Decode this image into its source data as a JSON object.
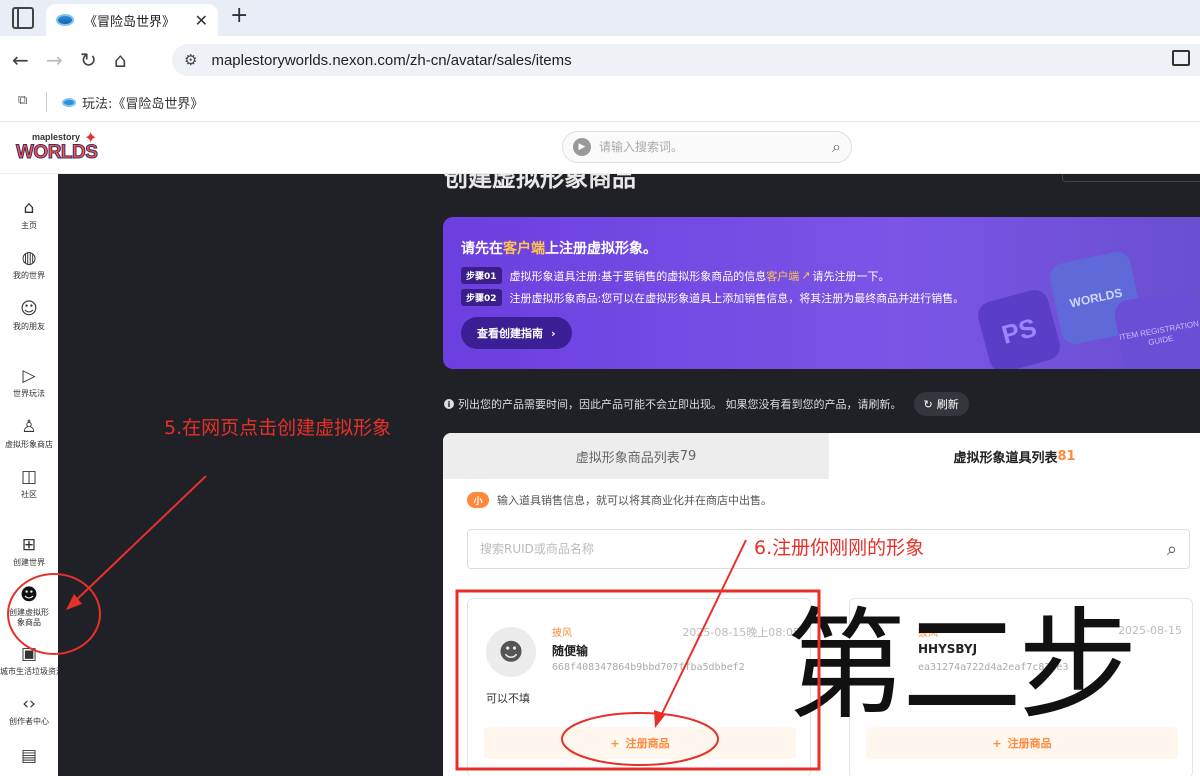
{
  "browser": {
    "tab_title": "《冒险岛世界》",
    "url": "maplestoryworlds.nexon.com/zh-cn/avatar/sales/items",
    "bookmark": "玩法:《冒险岛世界》"
  },
  "site": {
    "logo_small": "maplestory",
    "logo_big": "WORLDS",
    "search_placeholder": "请输入搜索词。"
  },
  "nav": [
    {
      "label": "主页"
    },
    {
      "label": "我的世界"
    },
    {
      "label": "我的朋友"
    },
    {
      "label": "世界玩法"
    },
    {
      "label": "虚拟形象商店"
    },
    {
      "label": "社区"
    },
    {
      "label": "创建世界"
    },
    {
      "label": "创建虚拟形象商品"
    },
    {
      "label": "城市生活垃圾资源"
    },
    {
      "label": "创作者中心"
    }
  ],
  "page": {
    "partial_title": "创建虚拟形象商品"
  },
  "banner": {
    "title_pre": "请先在",
    "title_hl": "客户端",
    "title_post": "上注册虚拟形象。",
    "step1_badge": "步骤01",
    "step1_pre": "虚拟形象道具注册:基于要销售的虚拟形象商品的信息",
    "step1_hl": "客户端",
    "step1_post": "请先注册一下。",
    "step2_badge": "步骤02",
    "step2_text": "注册虚拟形象商品:您可以在虚拟形象道具上添加销售信息，将其注册为最终商品并进行销售。",
    "guide_button": "查看创建指南",
    "deco_ps": "PS",
    "deco_worlds": "WORLDS",
    "deco_guide": "ITEM REGISTRATION GUIDE"
  },
  "notice": {
    "text": "列出您的产品需要时间，因此产品可能不会立即出现。 如果您没有看到您的产品，请刷新。",
    "refresh": "刷新"
  },
  "tabs": {
    "tab_a_label": "虚拟形象商品列表",
    "tab_a_count": "79",
    "tab_b_label": "虚拟形象道具列表",
    "tab_b_count": "81"
  },
  "tip": {
    "badge": "小",
    "text": "输入道具销售信息，就可以将其商业化并在商店中出售。"
  },
  "item_search_placeholder": "搜索RUID或商品名称",
  "cards": [
    {
      "category": "披风",
      "date": "2025-08-15晚上08:05",
      "name": "随便输",
      "id": "668f408347864b9bbd707ffba5dbbef2",
      "note": "可以不填",
      "register": "注册商品"
    },
    {
      "category": "披风",
      "date": "2025-08-15",
      "name": "HHYSBYJ",
      "id": "ea31274a722d4a2eaf7c873e3",
      "note": "",
      "register": "注册商品"
    }
  ],
  "annotations": {
    "step5": "5.在网页点击创建虚拟形象",
    "step6": "6.注册你刚刚的形象",
    "big": "第二步"
  },
  "colors": {
    "annotation_red": "#e8302a",
    "accent_orange": "#ff8a3d",
    "banner_purple": "#6c3fe0",
    "content_dark": "#1f2126"
  }
}
